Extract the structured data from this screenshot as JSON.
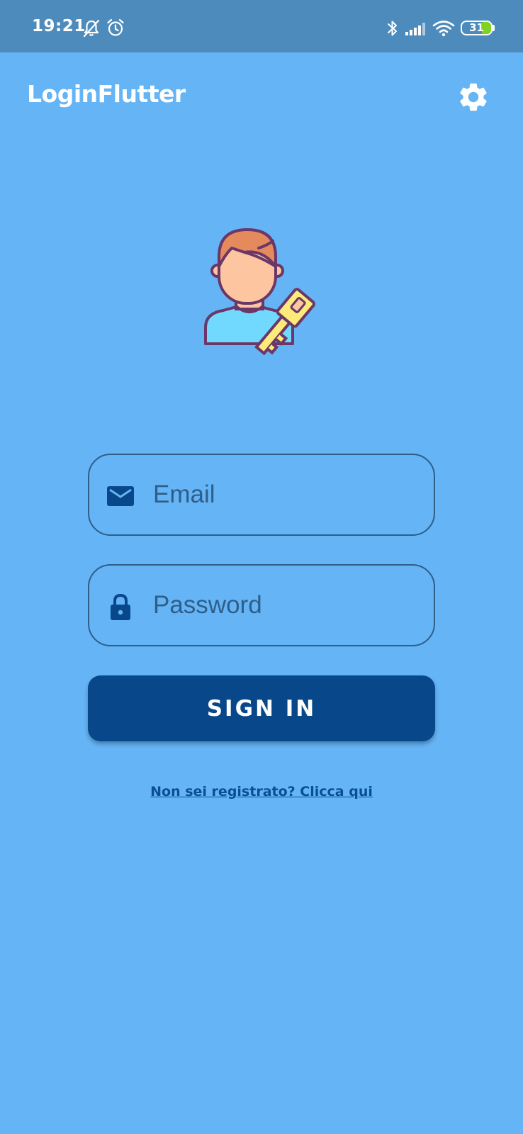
{
  "status_bar": {
    "time": "19:21",
    "battery_level": "31",
    "icons": [
      "notifications-off-icon",
      "alarm-icon",
      "bluetooth-icon",
      "signal-icon",
      "wifi-icon",
      "battery-icon"
    ],
    "battery_fraction": 0.31
  },
  "app_bar": {
    "title": "LoginFlutter",
    "settings_icon": "gear-icon"
  },
  "illustration": {
    "icon": "user-key-icon"
  },
  "form": {
    "email": {
      "placeholder": "Email",
      "value": "",
      "icon": "mail-icon"
    },
    "password": {
      "placeholder": "Password",
      "value": "",
      "icon": "lock-icon"
    },
    "sign_in_label": "SIGN IN",
    "register_link": "Non sei registrato? Clicca qui"
  },
  "colors": {
    "background": "#64b4f6",
    "status_bar": "#4d8bbd",
    "button": "#08488a",
    "field_border": "#2f5e88",
    "link": "#0a4f8f",
    "battery": "#7ed321"
  }
}
